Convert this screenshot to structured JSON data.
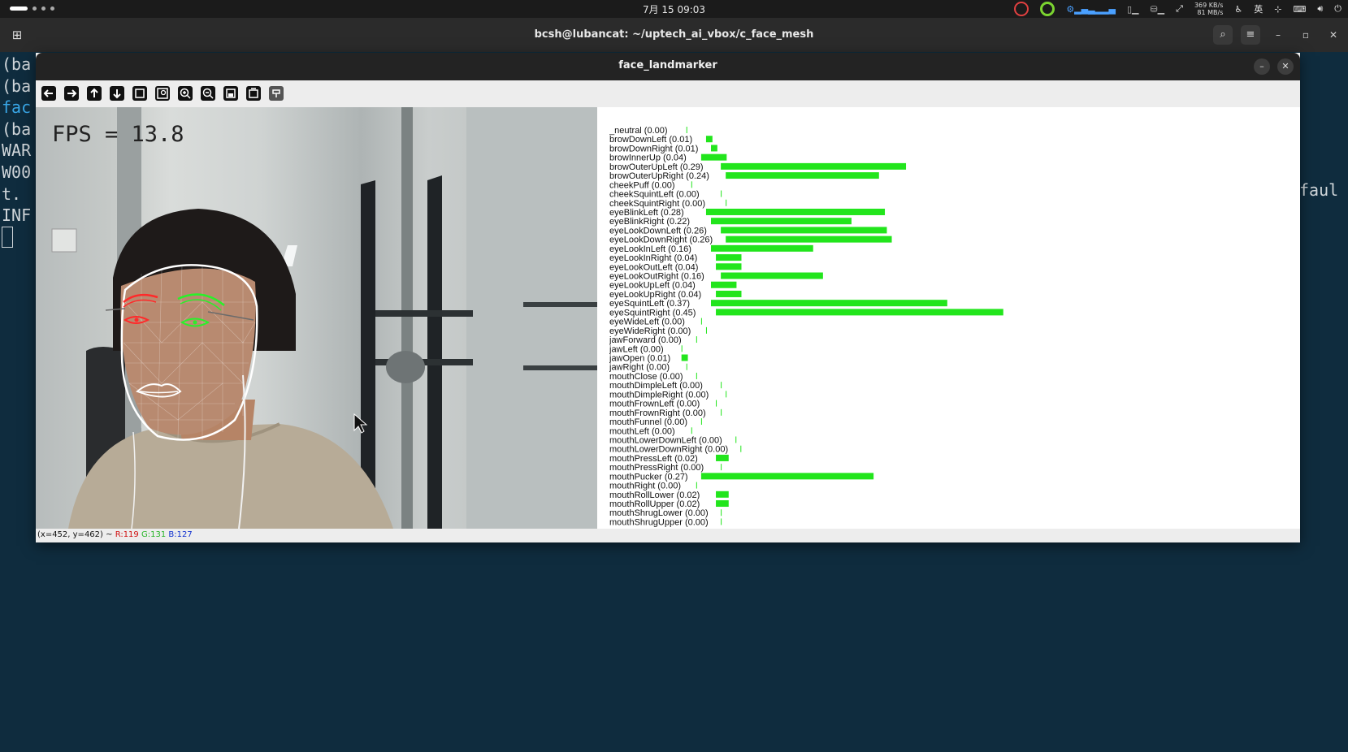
{
  "system_bar": {
    "clock": "7月 15  09:03",
    "net_up": "369 KB/s",
    "net_down": "81 MB/s",
    "input_method": "英"
  },
  "terminal": {
    "title": "bcsh@lubancat: ~/uptech_ai_vbox/c_face_mesh",
    "visible_lines": [
      "(ba",
      "(ba",
      "fac",
      "(ba",
      "WAR",
      "W00",
      "t.",
      "INF"
    ],
    "right_fragment": "faul"
  },
  "cv_window": {
    "title": "face_landmarker",
    "toolbar_icons": [
      "pan-left-icon",
      "pan-right-icon",
      "pan-up-icon",
      "pan-down-icon",
      "zoom-fit-icon",
      "zoom-original-icon",
      "zoom-in-icon",
      "zoom-out-icon",
      "save-icon",
      "copy-icon",
      "properties-icon"
    ],
    "fps_text": "FPS = 13.8",
    "status": {
      "coords": "(x=452, y=462) ~",
      "r": "R:119",
      "g": "G:131",
      "b": "B:127"
    }
  },
  "colors": {
    "bar": "#22e51c",
    "left_eye_landmarks": "#ff2a2a",
    "right_eye_landmarks": "#2af02a",
    "face_oval": "#ffffff"
  },
  "chart_data": {
    "type": "bar",
    "orientation": "horizontal",
    "series": [
      {
        "values": [
          0.0,
          0.01,
          0.01,
          0.04,
          0.29,
          0.24,
          0.0,
          0.0,
          0.0,
          0.28,
          0.22,
          0.26,
          0.26,
          0.16,
          0.04,
          0.04,
          0.16,
          0.04,
          0.04,
          0.37,
          0.45,
          0.0,
          0.0,
          0.0,
          0.0,
          0.01,
          0.0,
          0.0,
          0.0,
          0.0,
          0.0,
          0.0,
          0.0,
          0.0,
          0.0,
          0.0,
          0.02,
          0.0,
          0.27,
          0.0,
          0.02,
          0.02,
          0.0,
          0.0
        ]
      }
    ],
    "categories": [
      "_neutral (0.00)",
      "browDownLeft (0.01)",
      "browDownRight (0.01)",
      "browInnerUp (0.04)",
      "browOuterUpLeft (0.29)",
      "browOuterUpRight (0.24)",
      "cheekPuff (0.00)",
      "cheekSquintLeft (0.00)",
      "cheekSquintRight (0.00)",
      "eyeBlinkLeft (0.28)",
      "eyeBlinkRight (0.22)",
      "eyeLookDownLeft (0.26)",
      "eyeLookDownRight (0.26)",
      "eyeLookInLeft (0.16)",
      "eyeLookInRight (0.04)",
      "eyeLookOutLeft (0.04)",
      "eyeLookOutRight (0.16)",
      "eyeLookUpLeft (0.04)",
      "eyeLookUpRight (0.04)",
      "eyeSquintLeft (0.37)",
      "eyeSquintRight (0.45)",
      "eyeWideLeft (0.00)",
      "eyeWideRight (0.00)",
      "jawForward (0.00)",
      "jawLeft (0.00)",
      "jawOpen (0.01)",
      "jawRight (0.00)",
      "mouthClose (0.00)",
      "mouthDimpleLeft (0.00)",
      "mouthDimpleRight (0.00)",
      "mouthFrownLeft (0.00)",
      "mouthFrownRight (0.00)",
      "mouthFunnel (0.00)",
      "mouthLeft (0.00)",
      "mouthLowerDownLeft (0.00)",
      "mouthLowerDownRight (0.00)",
      "mouthPressLeft (0.02)",
      "mouthPressRight (0.00)",
      "mouthPucker (0.27)",
      "mouthRight (0.00)",
      "mouthRollLower (0.02)",
      "mouthRollUpper (0.02)",
      "mouthShrugLower (0.00)",
      "mouthShrugUpper (0.00)"
    ],
    "xlim": [
      0,
      0.57
    ],
    "grid": false,
    "legend": "none"
  }
}
